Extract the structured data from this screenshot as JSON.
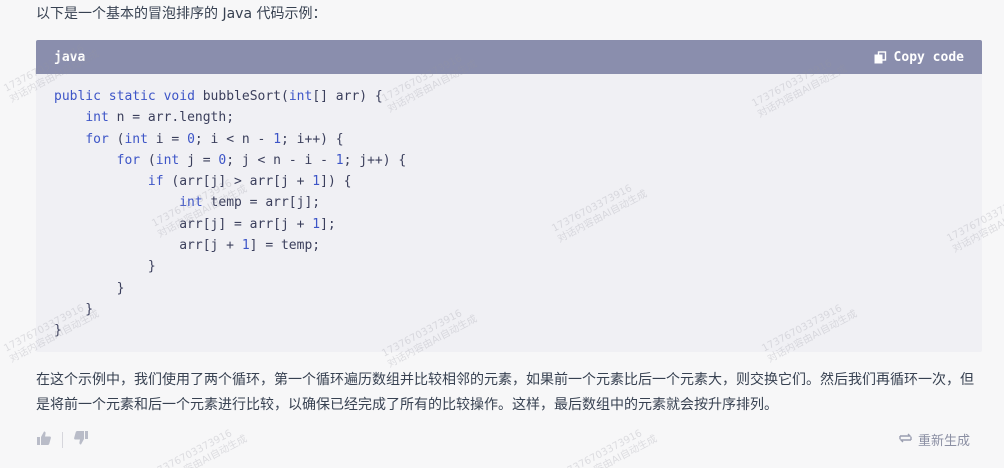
{
  "intro_text": "以下是一个基本的冒泡排序的 Java 代码示例：",
  "code_block": {
    "language": "java",
    "copy_label": "Copy code",
    "lines": [
      [
        [
          "kw",
          "public"
        ],
        [
          "t",
          " "
        ],
        [
          "kw",
          "static"
        ],
        [
          "t",
          " "
        ],
        [
          "kw",
          "void"
        ],
        [
          "t",
          " bubbleSort("
        ],
        [
          "kw",
          "int"
        ],
        [
          "t",
          "[] arr) {"
        ]
      ],
      [
        [
          "t",
          "    "
        ],
        [
          "kw",
          "int"
        ],
        [
          "t",
          " n = arr.length;"
        ]
      ],
      [
        [
          "t",
          "    "
        ],
        [
          "kw",
          "for"
        ],
        [
          "t",
          " ("
        ],
        [
          "kw",
          "int"
        ],
        [
          "t",
          " i = "
        ],
        [
          "num",
          "0"
        ],
        [
          "t",
          "; i < n - "
        ],
        [
          "num",
          "1"
        ],
        [
          "t",
          "; i++) {"
        ]
      ],
      [
        [
          "t",
          "        "
        ],
        [
          "kw",
          "for"
        ],
        [
          "t",
          " ("
        ],
        [
          "kw",
          "int"
        ],
        [
          "t",
          " j = "
        ],
        [
          "num",
          "0"
        ],
        [
          "t",
          "; j < n - i - "
        ],
        [
          "num",
          "1"
        ],
        [
          "t",
          "; j++) {"
        ]
      ],
      [
        [
          "t",
          "            "
        ],
        [
          "kw",
          "if"
        ],
        [
          "t",
          " (arr[j] > arr[j + "
        ],
        [
          "num",
          "1"
        ],
        [
          "t",
          "]) {"
        ]
      ],
      [
        [
          "t",
          "                "
        ],
        [
          "kw",
          "int"
        ],
        [
          "t",
          " temp = arr[j];"
        ]
      ],
      [
        [
          "t",
          "                arr[j] = arr[j + "
        ],
        [
          "num",
          "1"
        ],
        [
          "t",
          "];"
        ]
      ],
      [
        [
          "t",
          "                arr[j + "
        ],
        [
          "num",
          "1"
        ],
        [
          "t",
          "] = temp;"
        ]
      ],
      [
        [
          "t",
          "            }"
        ]
      ],
      [
        [
          "t",
          "        }"
        ]
      ],
      [
        [
          "t",
          "    }"
        ]
      ],
      [
        [
          "t",
          "}"
        ]
      ]
    ]
  },
  "summary_text": "在这个示例中，我们使用了两个循环，第一个循环遍历数组并比较相邻的元素，如果前一个元素比后一个元素大，则交换它们。然后我们再循环一次，但是将前一个元素和后一个元素进行比较，以确保已经完成了所有的比较操作。这样，最后数组中的元素就会按升序排列。",
  "actions": {
    "like_icon": "thumbs-up-icon",
    "dislike_icon": "thumbs-down-icon",
    "regenerate_icon": "regenerate-icon",
    "regenerate_label": "重新生成"
  },
  "watermark": {
    "line1": "17376703373916",
    "line2": "对话内容由AI自动生成"
  },
  "colors": {
    "code_header": "#8a8ead",
    "code_bg": "#f0f0f4",
    "keyword": "#3d55c7",
    "page_bg": "#f7f7f8"
  }
}
